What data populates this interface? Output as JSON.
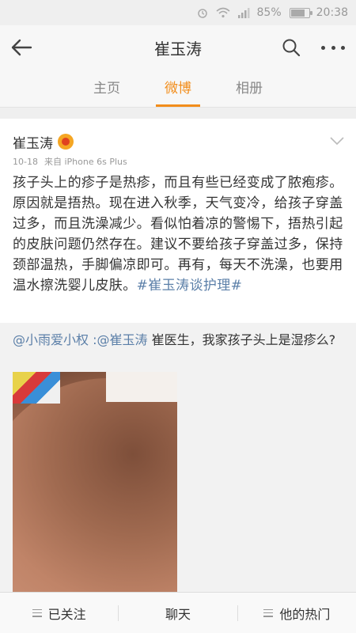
{
  "status_bar": {
    "battery": "85%",
    "battery_level": 0.85,
    "time": "20:38",
    "icons": [
      "alarm-icon",
      "wifi-icon",
      "signal-icon",
      "battery-icon"
    ]
  },
  "header": {
    "title": "崔玉涛",
    "icons": [
      "back-arrow-icon",
      "search-icon",
      "more-icon"
    ]
  },
  "tabs": [
    {
      "label": "主页",
      "active": false
    },
    {
      "label": "微博",
      "active": true
    },
    {
      "label": "相册",
      "active": false
    }
  ],
  "post": {
    "author": "崔玉涛",
    "date": "10-18",
    "source": "来自 iPhone 6s Plus",
    "text": "孩子头上的疹子是热疹，而且有些已经变成了脓疱疹。原因就是捂热。现在进入秋季，天气变冷，给孩子穿盖过多，而且洗澡减少。看似怕着凉的警惕下，捂热引起的皮肤问题仍然存在。建议不要给孩子穿盖过多，保持颈部温热，手脚偏凉即可。再有，每天不洗澡，也要用温水擦洗婴儿皮肤。",
    "hashtag": "#崔玉涛谈护理#"
  },
  "retweet": {
    "mention_user": "@小雨爱小权",
    "separator": " :",
    "mention_target": "@崔玉涛",
    "text": " 崔医生，我家孩子头上是湿疹么?"
  },
  "bottom_bar": {
    "items": [
      {
        "label": "已关注",
        "icon": "menu-icon"
      },
      {
        "label": "聊天",
        "icon": ""
      },
      {
        "label": "他的热门",
        "icon": "menu-icon"
      }
    ]
  },
  "colors": {
    "accent": "#f28d1b",
    "link": "#5b7fa8"
  }
}
